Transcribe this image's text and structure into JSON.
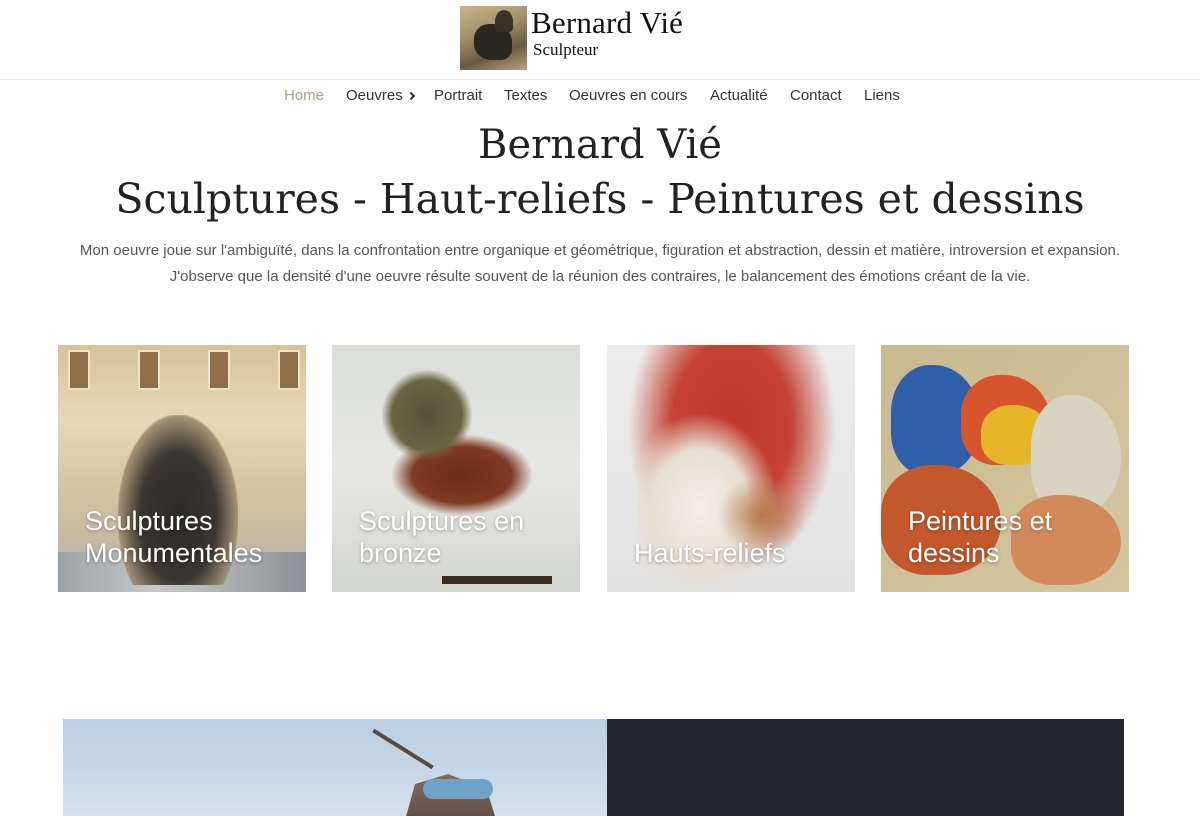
{
  "header": {
    "logo_name": "Bernard Vié",
    "logo_sub": "Sculpteur"
  },
  "nav": {
    "items": [
      {
        "label": "Home",
        "active": true
      },
      {
        "label": "Oeuvres",
        "has_submenu": true
      },
      {
        "label": "Portrait"
      },
      {
        "label": "Textes"
      },
      {
        "label": "Oeuvres en cours"
      },
      {
        "label": "Actualité"
      },
      {
        "label": "Contact"
      },
      {
        "label": "Liens"
      }
    ]
  },
  "hero": {
    "title_line1": "Bernard Vié",
    "title_line2": "Sculptures - Haut-reliefs - Peintures et dessins",
    "intro_line1": "Mon oeuvre joue sur l'ambiguïté, dans la confrontation entre organique et géométrique, figuration et abstraction, dessin et matière, introversion et expansion.",
    "intro_line2": "J'observe que la densité d'une oeuvre résulte souvent de la réunion des contraires, le balancement des émotions créant de la vie."
  },
  "cards": [
    {
      "label": "Sculptures Monumentales"
    },
    {
      "label": "Sculptures en bronze"
    },
    {
      "label": "Hauts-reliefs"
    },
    {
      "label": "Peintures et dessins"
    }
  ],
  "colors": {
    "nav_active": "#b0a07a",
    "dark_panel": "#23262b"
  }
}
